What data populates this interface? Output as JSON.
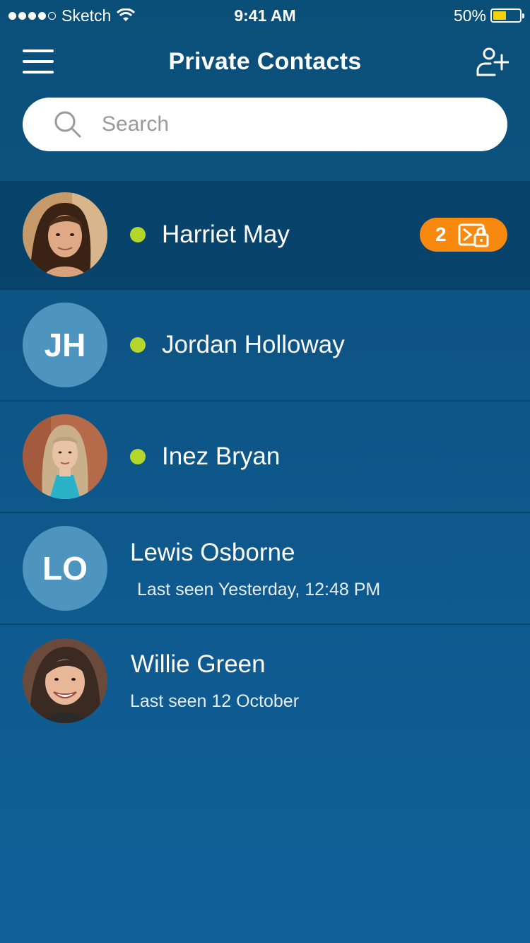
{
  "status_bar": {
    "carrier": "Sketch",
    "time": "9:41 AM",
    "battery_percent": "50%",
    "battery_level": 0.5,
    "signal_icon": "signal-dots-icon",
    "wifi_icon": "wifi-icon"
  },
  "header": {
    "title": "Private Contacts",
    "menu_icon": "hamburger-menu-icon",
    "add_icon": "add-contact-icon"
  },
  "search": {
    "placeholder": "Search",
    "value": ""
  },
  "colors": {
    "background": "#0d5586",
    "online": "#b5d62a",
    "badge": "#f7890f",
    "initials_avatar": "#4d95bf"
  },
  "contacts": [
    {
      "name": "Harriet May",
      "online": true,
      "avatar": "photo",
      "unread_count": "2",
      "badge_icon": "encrypted-message-icon"
    },
    {
      "name": "Jordan Holloway",
      "online": true,
      "avatar": "initials",
      "initials": "JH"
    },
    {
      "name": "Inez Bryan",
      "online": true,
      "avatar": "photo"
    },
    {
      "name": "Lewis Osborne",
      "online": false,
      "avatar": "initials",
      "initials": "LO",
      "last_seen": "Last seen Yesterday, 12:48 PM"
    },
    {
      "name": "Willie Green",
      "online": false,
      "avatar": "photo",
      "last_seen": "Last seen 12 October"
    }
  ]
}
